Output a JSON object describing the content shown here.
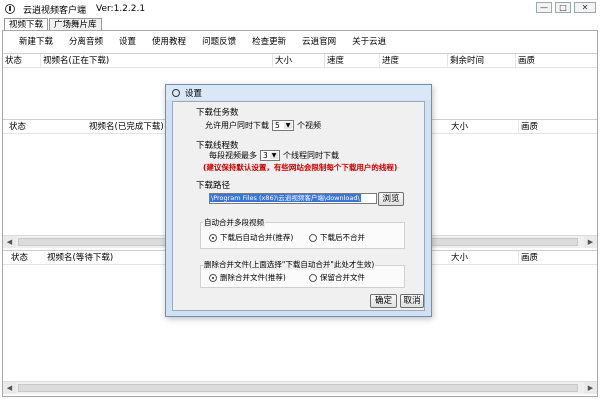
{
  "window": {
    "title": "云逍视频客户端",
    "version": "Ver:1.2.2.1",
    "minimize": "—",
    "maximize": "□",
    "close": "✕"
  },
  "tabs": [
    {
      "label": "视频下载"
    },
    {
      "label": "广场舞片库"
    }
  ],
  "menu": [
    {
      "label": "新建下载"
    },
    {
      "label": "分离音频"
    },
    {
      "label": "设置"
    },
    {
      "label": "使用教程"
    },
    {
      "label": "问题反馈"
    },
    {
      "label": "检查更新"
    },
    {
      "label": "云逍官网"
    },
    {
      "label": "关于云逍"
    }
  ],
  "tables": {
    "downloading": {
      "columns": [
        "状态",
        "视频名(正在下载)",
        "大小",
        "速度",
        "进度",
        "剩余时间",
        "画质"
      ]
    },
    "completed": {
      "columns": [
        "状态",
        "视频名(已完成下载)",
        "大小",
        "画质"
      ]
    },
    "waiting": {
      "columns": [
        "状态",
        "视频名(等待下载)",
        "大小",
        "画质"
      ]
    }
  },
  "settings_dialog": {
    "title": "设置",
    "task_count": {
      "heading": "下载任务数",
      "prefix": "允许用户同时下载",
      "value": "5",
      "suffix": "个视频"
    },
    "thread_count": {
      "heading": "下载线程数",
      "prefix": "每段视频最多",
      "value": "3",
      "suffix": "个线程同时下载",
      "warning": "(建议保持默认设置，有些网站会限制每个下载用户的线程)"
    },
    "path": {
      "heading": "下载路径",
      "value": "\\Program Files (x86)\\云逍视频客户端\\download\\",
      "browse": "浏览"
    },
    "auto_merge": {
      "label": "自动合并多段视频",
      "option_on": "下载后自动合并(推荐)",
      "option_off": "下载后不合并",
      "selected": "option_on"
    },
    "delete_merged": {
      "label": "删除合并文件(上面选择\"下载自动合并\"此处才生效)",
      "option_on": "删除合并文件(推荐)",
      "option_off": "保留合并文件",
      "selected": "option_on"
    },
    "ok": "确定",
    "cancel": "取消"
  },
  "icons": [
    "app-icon",
    "settings-dialog-icon",
    "dropdown-caret-icon",
    "scroll-left-icon",
    "scroll-right-icon"
  ],
  "colors": {
    "dialog_frame": "#cfe1f3",
    "warning": "#cc0000",
    "selection": "#3875d7"
  }
}
